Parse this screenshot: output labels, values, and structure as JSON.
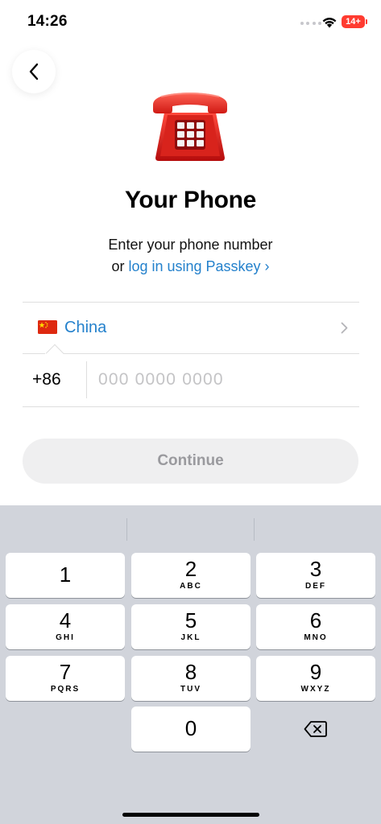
{
  "status_bar": {
    "time": "14:26",
    "battery": "14+",
    "icons": [
      "signal-dots-icon",
      "wifi-icon",
      "battery-icon"
    ]
  },
  "header": {
    "back_icon": "chevron-left-icon",
    "illustration": "telephone-icon"
  },
  "title": "Your Phone",
  "subtitle": {
    "line1": "Enter your phone number",
    "line2_prefix": "or ",
    "passkey_link": "log in using Passkey ›"
  },
  "country": {
    "flag": "china-flag-icon",
    "name": "China",
    "chevron": "chevron-right-icon"
  },
  "phone": {
    "code": "+86",
    "value": "",
    "placeholder": "000 0000 0000"
  },
  "continue_label": "Continue",
  "colors": {
    "accent": "#2481cc",
    "button_bg": "#efeff0",
    "button_text": "#9a9a9e",
    "keyboard_bg": "#d1d4db"
  },
  "keypad": {
    "keys": [
      {
        "digit": "1",
        "letters": ""
      },
      {
        "digit": "2",
        "letters": "ABC"
      },
      {
        "digit": "3",
        "letters": "DEF"
      },
      {
        "digit": "4",
        "letters": "GHI"
      },
      {
        "digit": "5",
        "letters": "JKL"
      },
      {
        "digit": "6",
        "letters": "MNO"
      },
      {
        "digit": "7",
        "letters": "PQRS"
      },
      {
        "digit": "8",
        "letters": "TUV"
      },
      {
        "digit": "9",
        "letters": "WXYZ"
      },
      {
        "digit": "0",
        "letters": ""
      }
    ],
    "delete_icon": "backspace-icon"
  }
}
